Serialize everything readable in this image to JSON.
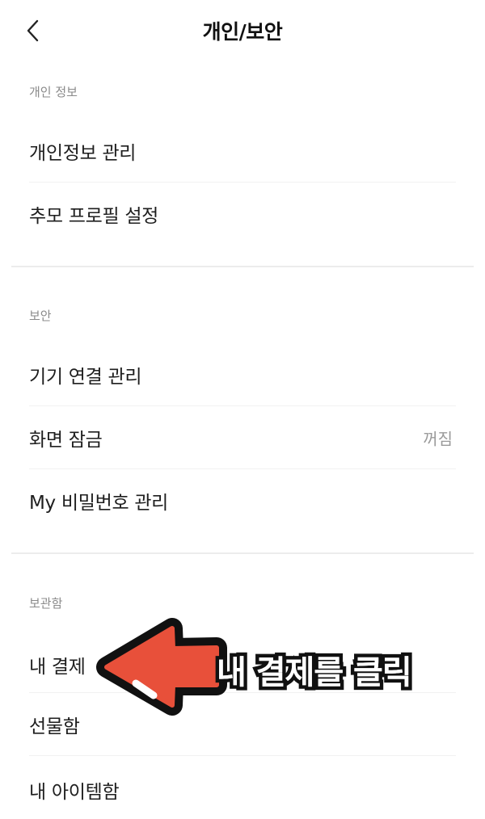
{
  "header": {
    "title": "개인/보안",
    "back_icon": "chevron-left-icon"
  },
  "sections": [
    {
      "label": "개인 정보",
      "items": [
        {
          "label": "개인정보 관리"
        },
        {
          "label": "추모 프로필 설정"
        }
      ]
    },
    {
      "label": "보안",
      "items": [
        {
          "label": "기기 연결 관리"
        },
        {
          "label": "화면 잠금",
          "value": "꺼짐"
        },
        {
          "label": "My 비밀번호 관리"
        }
      ]
    },
    {
      "label": "보관함",
      "items": [
        {
          "label": "내 결제"
        },
        {
          "label": "선물함"
        },
        {
          "label": "내 아이템함"
        }
      ]
    }
  ],
  "annotation": {
    "caption": "내 결제를 클릭",
    "arrow_color": "#e8503a",
    "outline_color": "#111111"
  }
}
